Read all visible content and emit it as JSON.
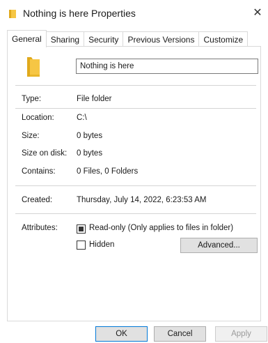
{
  "window": {
    "title": "Nothing is here Properties",
    "close_glyph": "✕",
    "folder_color": "#f6c644"
  },
  "tabs": [
    {
      "label": "General",
      "active": true
    },
    {
      "label": "Sharing",
      "active": false
    },
    {
      "label": "Security",
      "active": false
    },
    {
      "label": "Previous Versions",
      "active": false
    },
    {
      "label": "Customize",
      "active": false
    }
  ],
  "general": {
    "folder_name": "Nothing is here",
    "type_label": "Type:",
    "type_value": "File folder",
    "location_label": "Location:",
    "location_value": "C:\\",
    "size_label": "Size:",
    "size_value": "0 bytes",
    "size_on_disk_label": "Size on disk:",
    "size_on_disk_value": "0 bytes",
    "contains_label": "Contains:",
    "contains_value": "0 Files, 0 Folders",
    "created_label": "Created:",
    "created_value": "Thursday, July 14, 2022, 6:23:53 AM",
    "attributes_label": "Attributes:",
    "readonly_label": "Read-only (Only applies to files in folder)",
    "readonly_state": "indeterminate",
    "hidden_label": "Hidden",
    "hidden_state": "unchecked",
    "advanced_label": "Advanced..."
  },
  "footer": {
    "ok_label": "OK",
    "cancel_label": "Cancel",
    "apply_label": "Apply",
    "apply_enabled": false
  },
  "colors": {
    "accent": "#0078d7",
    "border": "#d9d9d9",
    "button_bg": "#e1e1e1"
  }
}
